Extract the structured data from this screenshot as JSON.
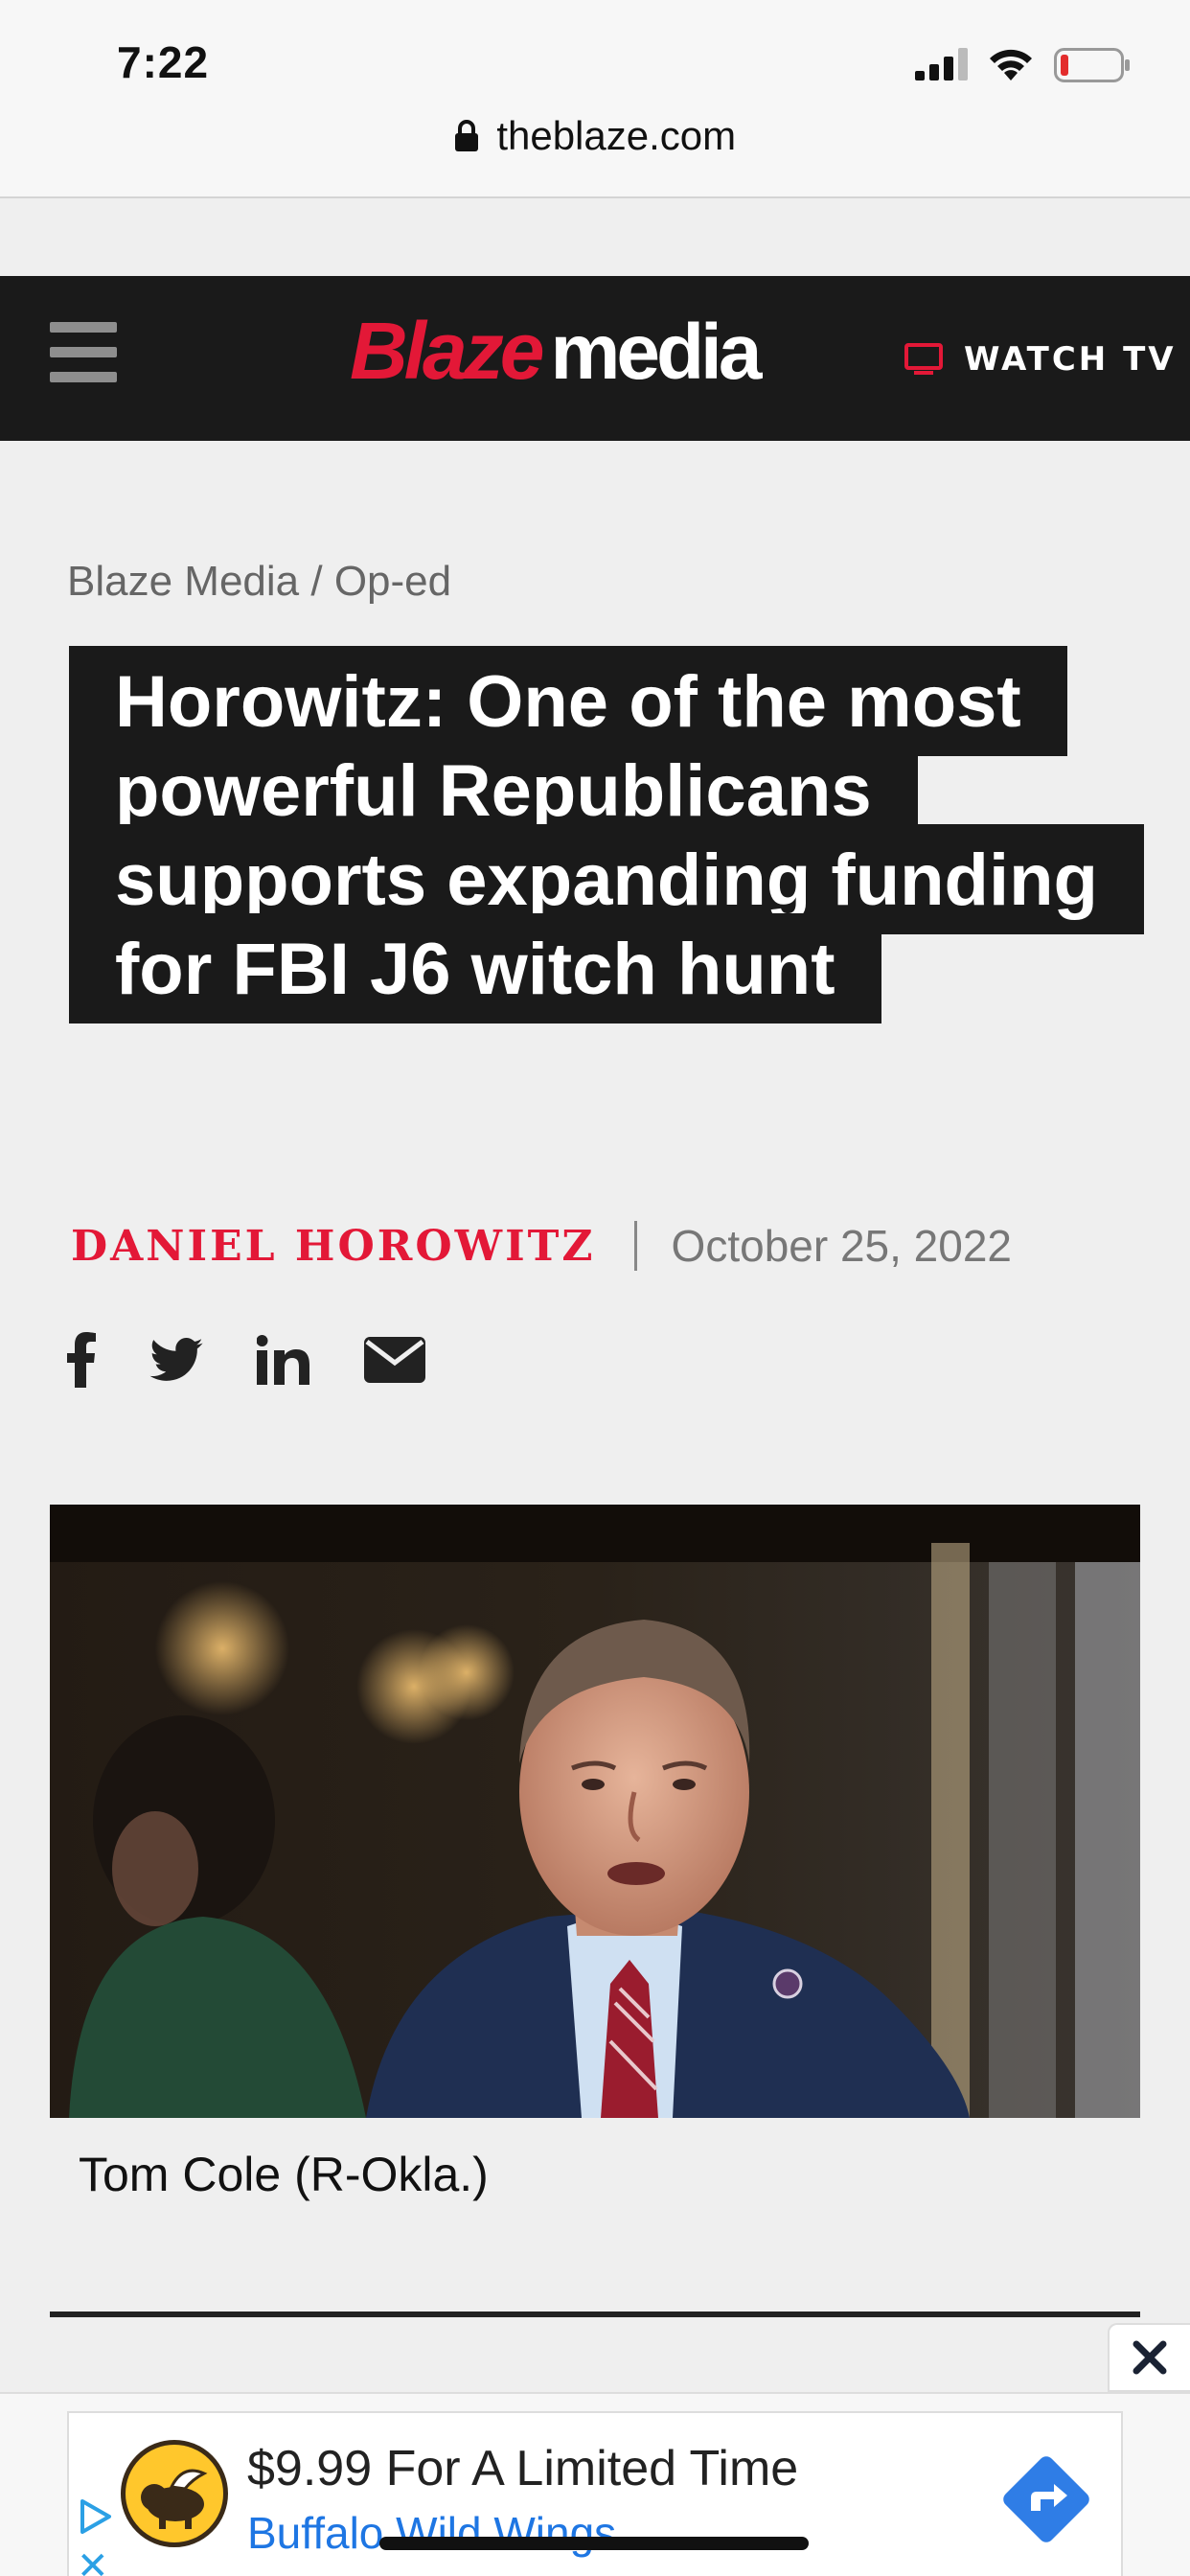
{
  "status_bar": {
    "time": "7:22",
    "url": "theblaze.com"
  },
  "header": {
    "logo_part1": "Blaze",
    "logo_part2": "media",
    "watch_tv_label": "WATCH TV",
    "brand_color": "#e31837"
  },
  "breadcrumb": {
    "items": [
      "Blaze Media",
      "Op-ed"
    ],
    "separator": " / "
  },
  "article": {
    "headline": "Horowitz: One of the most powerful Republicans supports expanding funding for FBI J6 witch hunt",
    "author": "DANIEL HOROWITZ",
    "date": "October 25, 2022",
    "share_icons": [
      "facebook-icon",
      "twitter-icon",
      "linkedin-icon",
      "email-icon"
    ],
    "image_caption": "Tom Cole (R-Okla.)"
  },
  "ad": {
    "title": "$9.99 For A Limited Time",
    "advertiser": "Buffalo Wild Wings"
  }
}
